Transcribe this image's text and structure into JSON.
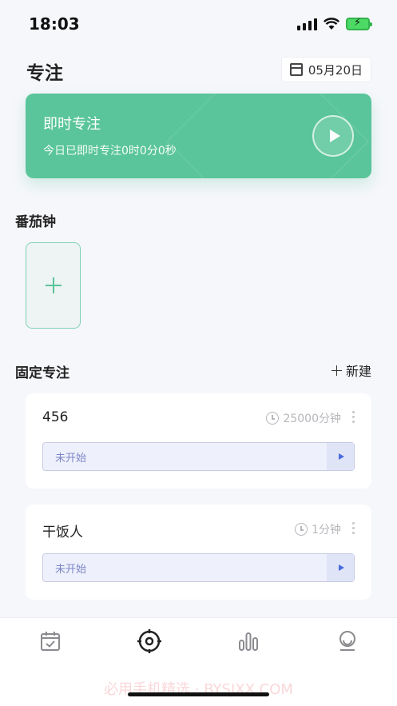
{
  "status_bar": {
    "time": "18:03"
  },
  "header": {
    "title": "专注",
    "date": "05月20日"
  },
  "instant_focus": {
    "title": "即时专注",
    "subtitle": "今日已即时专注0时0分0秒"
  },
  "tomato": {
    "section_title": "番茄钟"
  },
  "fixed_focus": {
    "section_title": "固定专注",
    "new_label": "新建",
    "tasks": [
      {
        "name": "456",
        "duration": "25000分钟",
        "status": "未开始"
      },
      {
        "name": "干饭人",
        "duration": "1分钟",
        "status": "未开始"
      }
    ]
  },
  "tab_bar": {
    "items": [
      {
        "icon": "calendar-check-icon"
      },
      {
        "icon": "target-icon",
        "active": true
      },
      {
        "icon": "bar-chart-icon"
      },
      {
        "icon": "profile-icon"
      }
    ]
  },
  "watermark": "必用手机精选 · BYSJXX.COM",
  "colors": {
    "accent_green": "#5ac59a",
    "status_blue": "#7c86c7"
  }
}
